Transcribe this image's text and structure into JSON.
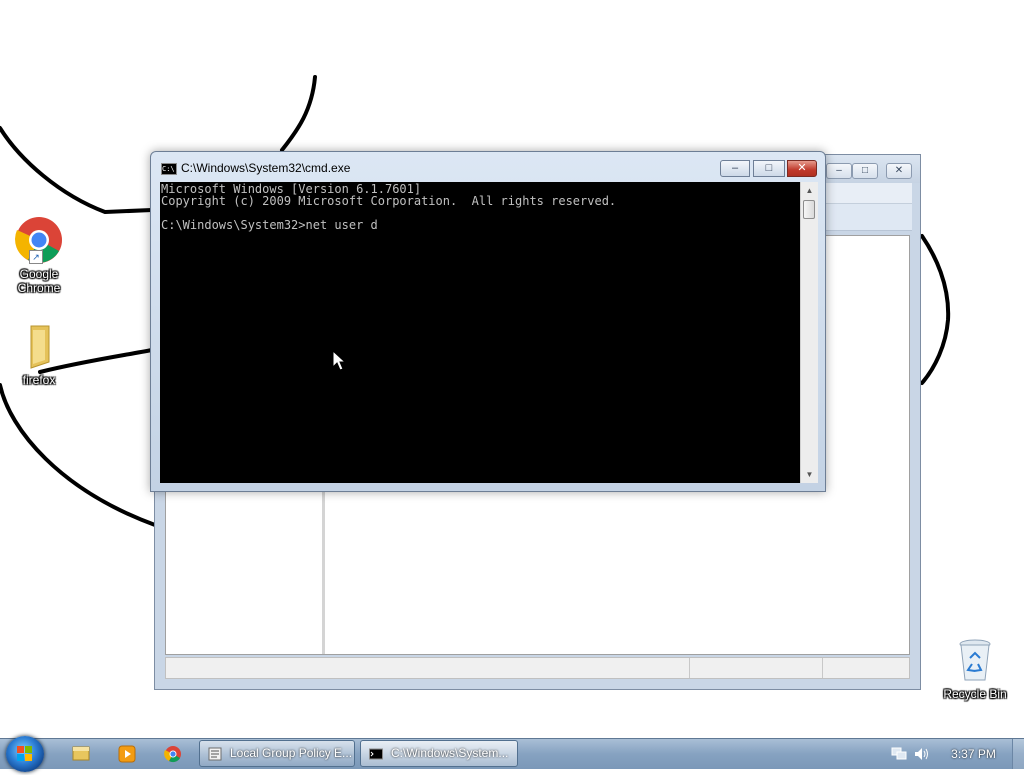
{
  "desktop": {
    "icons": [
      {
        "label": "Google Chrome",
        "icon": "chrome-icon"
      },
      {
        "label": "firefox",
        "icon": "folder-icon"
      },
      {
        "label": "Recycle Bin",
        "icon": "recycle-bin-icon"
      }
    ]
  },
  "cmd_window": {
    "title": "C:\\Windows\\System32\\cmd.exe",
    "controls": {
      "minimize": "–",
      "maximize": "□",
      "close": "✕"
    },
    "lines": [
      "Microsoft Windows [Version 6.1.7601]",
      "Copyright (c) 2009 Microsoft Corporation.  All rights reserved.",
      "",
      "C:\\Windows\\System32>net user d"
    ]
  },
  "gpe_window": {
    "controls": {
      "minimize": "–",
      "maximize": "□",
      "close": "✕"
    }
  },
  "taskbar": {
    "pinned": [
      "windows-explorer-icon",
      "media-player-icon",
      "chrome-icon"
    ],
    "buttons": [
      {
        "label": "Local Group Policy E...",
        "icon": "group-policy-icon"
      },
      {
        "label": "C:\\Windows\\System...",
        "icon": "cmd-icon",
        "active": true
      }
    ],
    "clock": "3:37 PM"
  },
  "colors": {
    "console_bg": "#000000",
    "console_text": "#c0c0c0",
    "taskbar": "#86a2c1",
    "close_button": "#c0392b"
  }
}
